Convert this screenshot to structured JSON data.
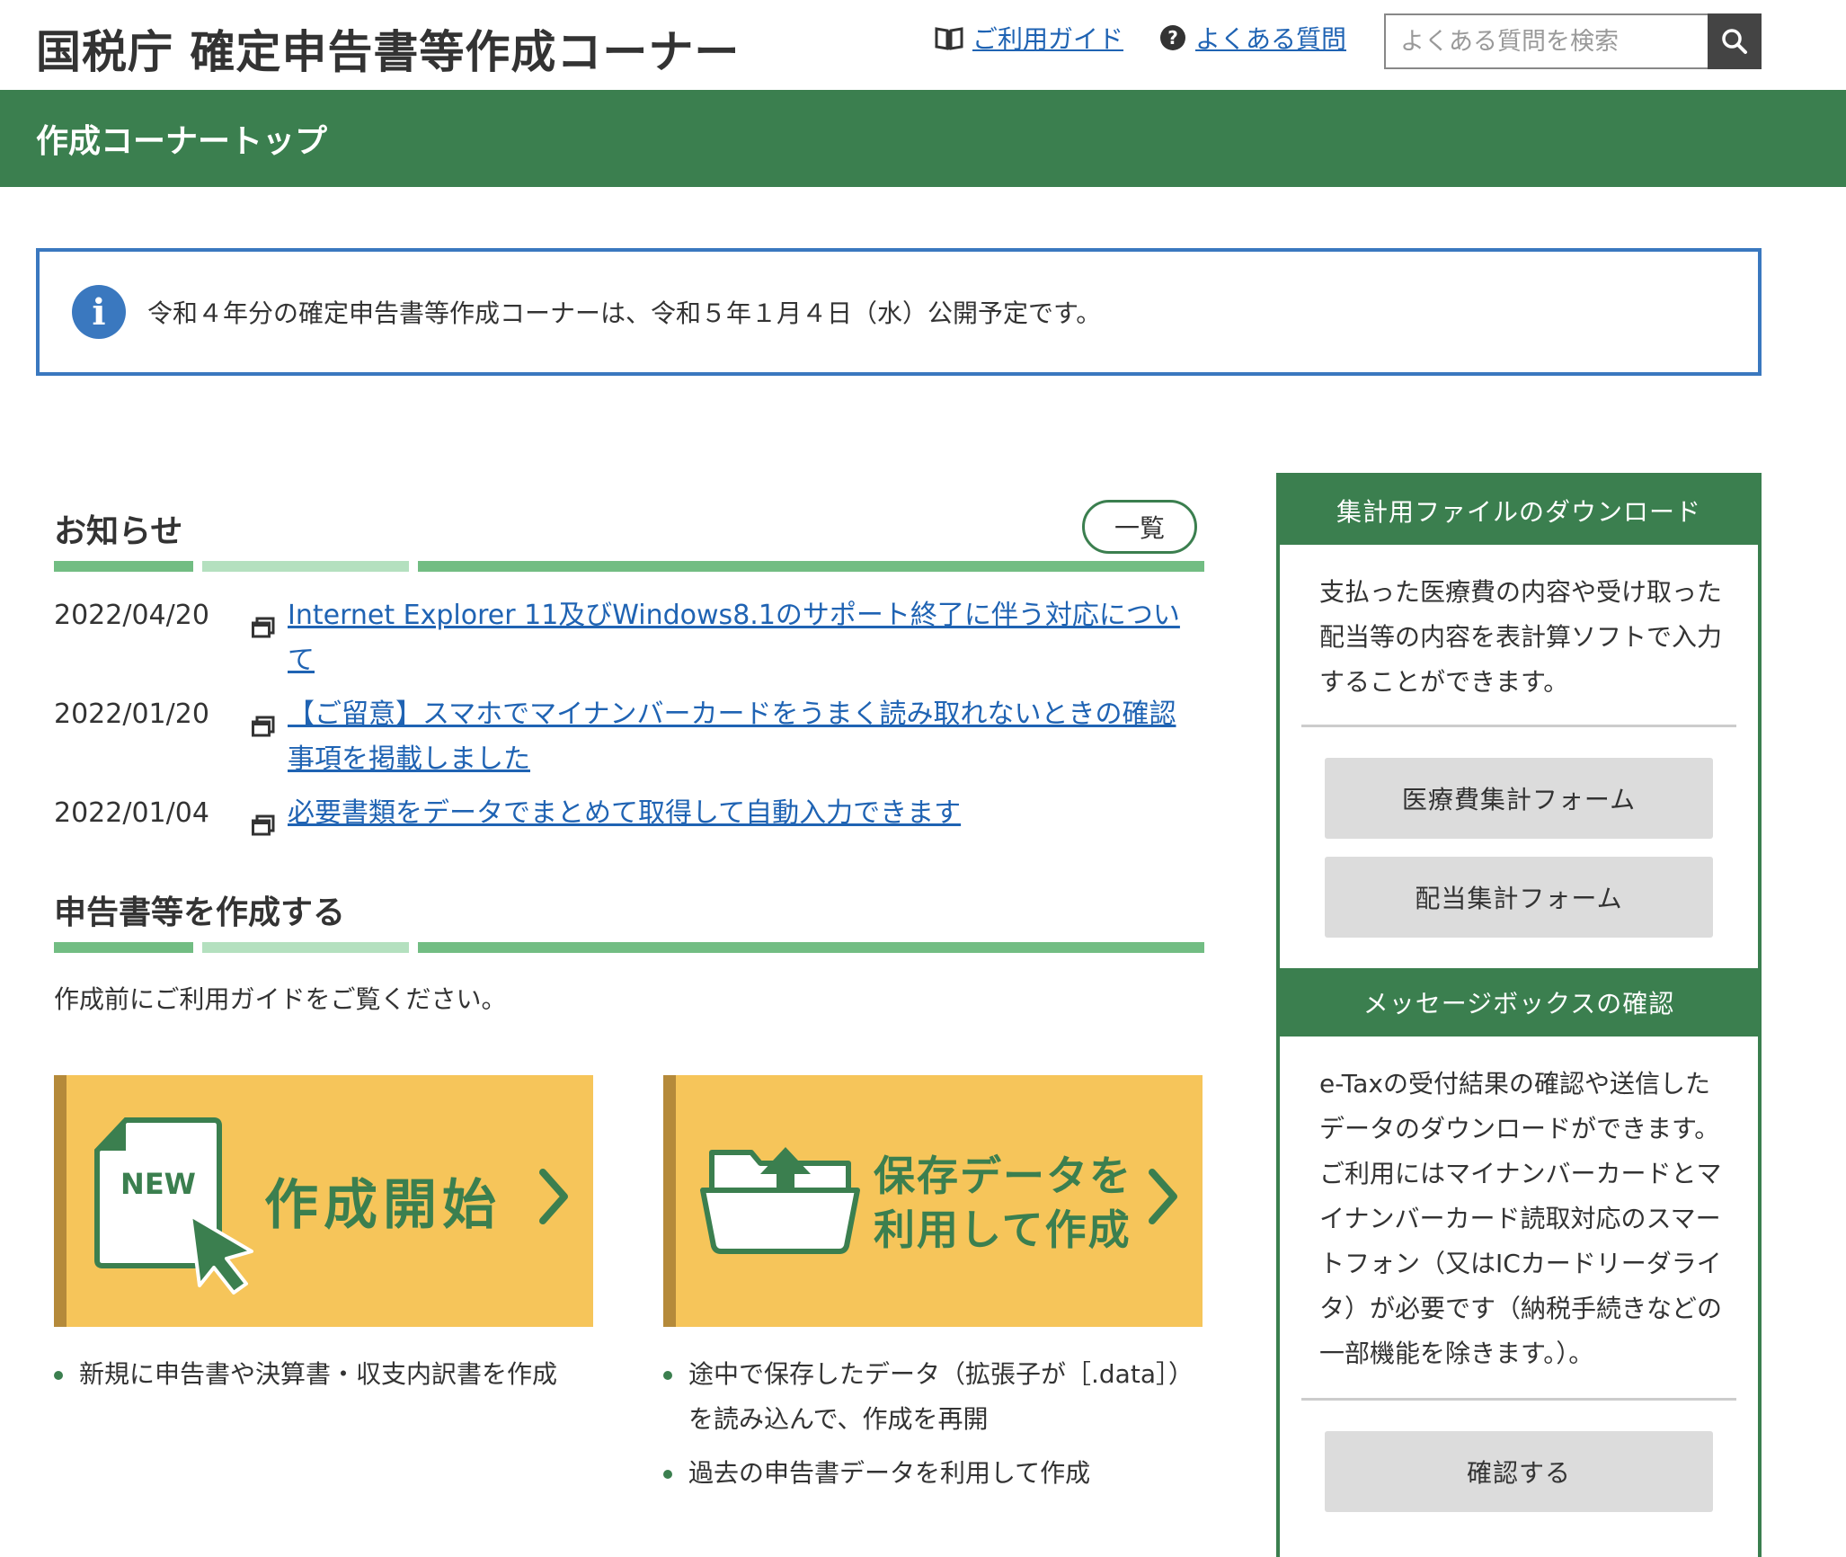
{
  "header": {
    "site_title": "国税庁 確定申告書等作成コーナー",
    "guide_link": "ご利用ガイド",
    "faq_link": "よくある質問",
    "search_placeholder": "よくある質問を検索"
  },
  "topbar": {
    "title": "作成コーナートップ"
  },
  "info": {
    "icon_label": "i",
    "message": "令和４年分の確定申告書等作成コーナーは、令和５年１月４日（水）公開予定です。"
  },
  "news": {
    "title": "お知らせ",
    "list_button": "一覧",
    "items": [
      {
        "date": "2022/04/20",
        "text": "Internet Explorer 11及びWindows8.1のサポート終了に伴う対応について"
      },
      {
        "date": "2022/01/20",
        "text": "【ご留意】スマホでマイナンバーカードをうまく読み取れないときの確認事項を掲載しました"
      },
      {
        "date": "2022/01/04",
        "text": "必要書類をデータでまとめて取得して自動入力できます"
      }
    ]
  },
  "create": {
    "title": "申告書等を作成する",
    "intro": "作成前にご利用ガイドをご覧ください。",
    "new_card": {
      "badge": "NEW",
      "title": "作成開始"
    },
    "saved_card": {
      "title_line1": "保存データを",
      "title_line2": "利用して作成"
    },
    "new_bullets": [
      "新規に申告書や決算書・収支内訳書を作成"
    ],
    "saved_bullets": [
      "途中で保存したデータ（拡張子が［.data］）を読み込んで、作成を再開",
      "過去の申告書データを利用して作成"
    ]
  },
  "side": {
    "download": {
      "title": "集計用ファイルのダウンロード",
      "desc": "支払った医療費の内容や受け取った配当等の内容を表計算ソフトで入力することができます。",
      "medical_button": "医療費集計フォーム",
      "dividend_button": "配当集計フォーム"
    },
    "message": {
      "title": "メッセージボックスの確認",
      "desc": "e-Taxの受付結果の確認や送信したデータのダウンロードができます。ご利用にはマイナンバーカードとマイナンバーカード読取対応のスマートフォン（又はICカードリーダライタ）が必要です（納税手続きなどの一部機能を除きます。）。",
      "confirm_button": "確認する"
    }
  },
  "colors": {
    "brand_green": "#3b7f4f",
    "info_blue": "#3a78bf",
    "card_yellow": "#f6c55a",
    "link_blue": "#1f63b3"
  },
  "icons": [
    "book-icon",
    "question-icon",
    "search-icon",
    "info-icon",
    "external-window-icon",
    "new-document-icon",
    "cursor-arrow-icon",
    "folder-upload-icon",
    "chevron-right-icon"
  ]
}
